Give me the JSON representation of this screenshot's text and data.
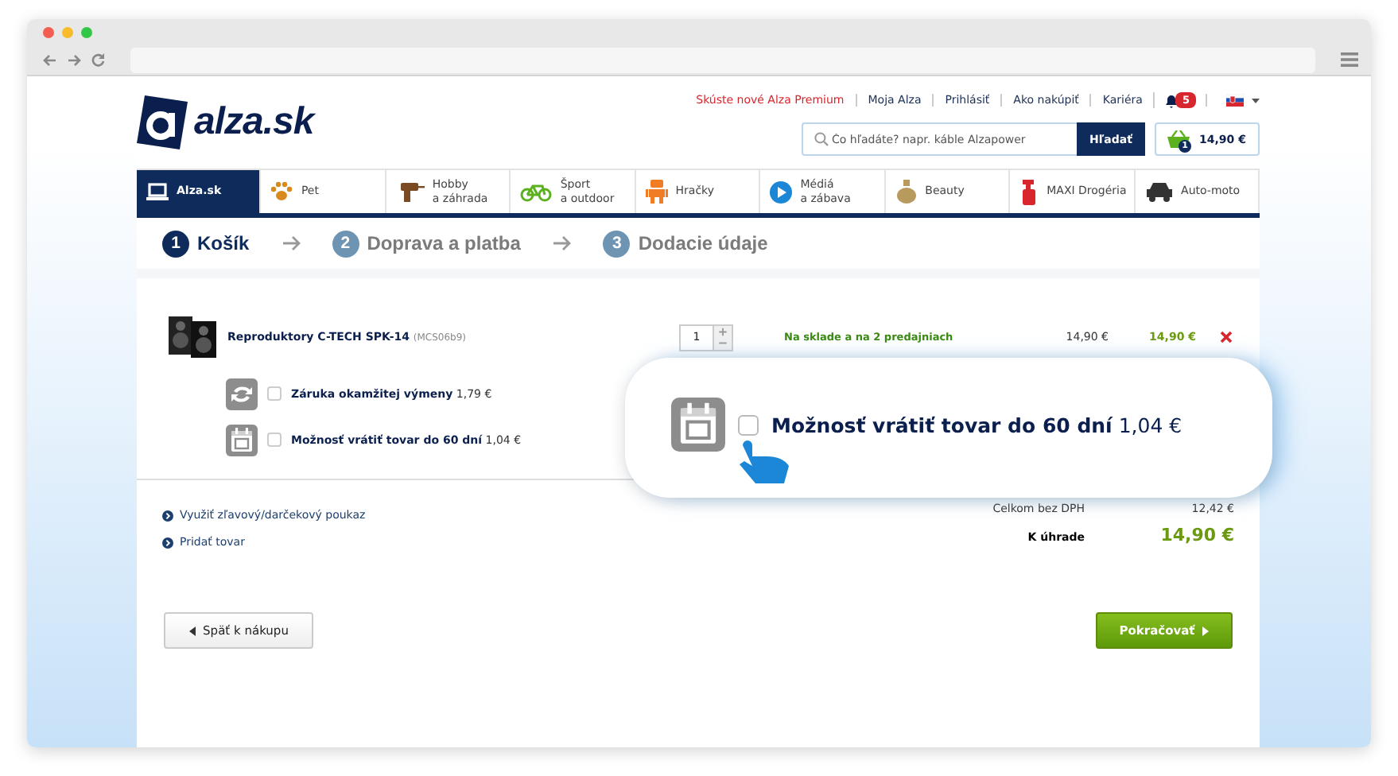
{
  "header": {
    "logo_word": "alza",
    "logo_suffix": ".sk",
    "top_links": [
      {
        "label": "Skúste nové Alza Premium",
        "highlighted": true
      },
      {
        "label": "Moja Alza",
        "highlighted": false
      },
      {
        "label": "Prihlásiť",
        "highlighted": false
      },
      {
        "label": "Ako nakúpiť",
        "highlighted": false
      },
      {
        "label": "Kariéra",
        "highlighted": false
      }
    ],
    "notifications": "5",
    "search": {
      "placeholder": "Čo hľadáte? napr. káble Alzapower",
      "button": "Hľadať"
    },
    "cart": {
      "count": "1",
      "total": "14,90 €"
    }
  },
  "categories": [
    {
      "label": "Alza.sk",
      "kind": "laptop",
      "selected": true
    },
    {
      "label": "Pet",
      "kind": "paw",
      "selected": false
    },
    {
      "label": "Hobby\na záhrada",
      "kind": "drill",
      "selected": false
    },
    {
      "label": "Šport\na outdoor",
      "kind": "bike",
      "selected": false
    },
    {
      "label": "Hračky",
      "kind": "robot",
      "selected": false
    },
    {
      "label": "Médiá\na zábava",
      "kind": "play",
      "selected": false
    },
    {
      "label": "Beauty",
      "kind": "bottle",
      "selected": false
    },
    {
      "label": "MAXI Drogéria",
      "kind": "spray",
      "selected": false
    },
    {
      "label": "Auto-moto",
      "kind": "car",
      "selected": false
    }
  ],
  "steps": [
    {
      "number": "1",
      "label": "Košík",
      "selected": true
    },
    {
      "number": "2",
      "label": "Doprava a platba",
      "selected": false
    },
    {
      "number": "3",
      "label": "Dodacie údaje",
      "selected": false
    }
  ],
  "cart": {
    "item": {
      "name": "Reproduktory C-TECH SPK-14",
      "code": "(MCS06b9)",
      "quantity": "1",
      "availability": "Na sklade a na 2 predajniach",
      "price": "14,90 €",
      "total": "14,90 €"
    },
    "addons": [
      {
        "kind": "exchange",
        "label": "Záruka okamžitej výmeny",
        "price": "1,79 €",
        "checked": false
      },
      {
        "kind": "calendar",
        "label": "Možnosť vrátiť tovar do 60 dní",
        "price": "1,04 €",
        "checked": false
      }
    ],
    "links": [
      "Využiť zľavový/darčekový poukaz",
      "Pridať tovar"
    ],
    "summary": [
      {
        "label": "Celkom bez DPH",
        "value": "12,42 €",
        "kind": "net"
      },
      {
        "label": "K úhrade",
        "value": "14,90 €",
        "kind": "total"
      }
    ],
    "back_button": "Späť k nákupu",
    "continue_button": "Pokračovať"
  },
  "callout": {
    "label": "Možnosť vrátiť tovar do 60 dní",
    "price": "1,04 €",
    "checked": false
  }
}
